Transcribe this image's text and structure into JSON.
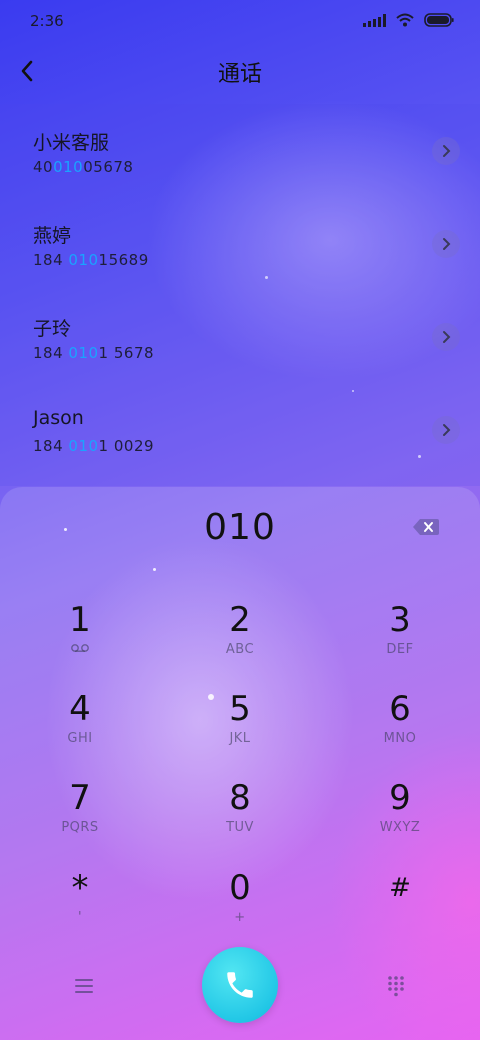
{
  "status_bar": {
    "time": "2:36",
    "icons": [
      "signal-icon",
      "wifi-icon",
      "battery-icon"
    ]
  },
  "header": {
    "title": "通话",
    "back_icon": "back-arrow-icon"
  },
  "contacts": [
    {
      "name": "小米客服",
      "number_pre": "40",
      "number_match": "010",
      "number_post": "05678"
    },
    {
      "name": "燕婷",
      "number_pre": "184 ",
      "number_match": "010",
      "number_post": "15689"
    },
    {
      "name": "子玲",
      "number_pre": "184 ",
      "number_match": "010",
      "number_post": "1 5678"
    },
    {
      "name": "Jason",
      "number_pre": "184 ",
      "number_match": "010",
      "number_post": "1 0029"
    }
  ],
  "dialpad": {
    "input": "010",
    "keys": [
      {
        "digit": "1",
        "sub": "",
        "sub_icon": "voicemail-icon"
      },
      {
        "digit": "2",
        "sub": "ABC"
      },
      {
        "digit": "3",
        "sub": "DEF"
      },
      {
        "digit": "4",
        "sub": "GHI"
      },
      {
        "digit": "5",
        "sub": "JKL"
      },
      {
        "digit": "6",
        "sub": "MNO"
      },
      {
        "digit": "7",
        "sub": "PQRS"
      },
      {
        "digit": "8",
        "sub": "TUV"
      },
      {
        "digit": "9",
        "sub": "WXYZ"
      },
      {
        "digit": "*",
        "sub": "'"
      },
      {
        "digit": "0",
        "sub": "+"
      },
      {
        "digit": "#",
        "sub": ""
      }
    ]
  },
  "bottom_bar": {
    "menu_icon": "menu-icon",
    "call_icon": "phone-icon",
    "keypad_icon": "dialpad-icon"
  },
  "colors": {
    "highlight": "#1aa3ff",
    "call_button": "#22c7e6"
  }
}
